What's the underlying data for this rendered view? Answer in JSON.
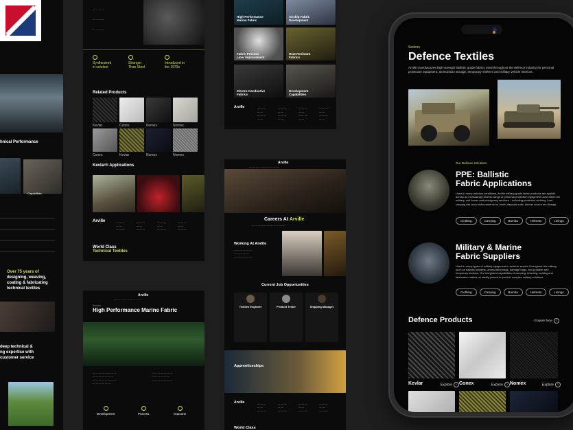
{
  "page1": {
    "hero_l1": "Synthesised",
    "hero_l1b": "in solution",
    "hero_l2": "Stronger",
    "hero_l2b": "Than Steel",
    "hero_l3": "Introduced in",
    "hero_l3b": "the 1970s",
    "related_title": "Related Products",
    "prod_row1": [
      "Kevlar",
      "Conex",
      "Nomex",
      "Nomex"
    ],
    "prod_row2": [
      "Conex",
      "Kevlar",
      "Nomex",
      "Nomex"
    ],
    "applications_title": "Kevlar® Applications",
    "brand": "Arville",
    "world_class_l1": "World Class",
    "world_class_l2": "Technical Textiles"
  },
  "page2": {
    "tile1": "High Performance",
    "tile1b": "Marine Fabric",
    "tile2": "Airship Fabric",
    "tile2b": "Development",
    "tile3": "Fabric Process",
    "tile3b": "Liner Improvement",
    "tile4": "Heat Resistant",
    "tile4b": "Fabrics",
    "tile5": "Electro-Conductive",
    "tile5b": "Fabrics",
    "tile6": "Development",
    "tile6b": "Capabilities",
    "brand": "Arville"
  },
  "page_left": {
    "perf": "hnical Performance",
    "capabilities": "Capabilities",
    "over": "Over 75 years of",
    "over2": "designing, weaving,",
    "over3": "coating & fabricating",
    "over4": "technical textiles",
    "deep1": "deep technical &",
    "deep2": "ng expertise with",
    "deep3": "customer service"
  },
  "page3": {
    "brand": "Arville",
    "breadcrumb": "Sectors",
    "title": "High Performance Marine Fabric",
    "step1": "Development",
    "step2": "Process",
    "step3": "Outcome"
  },
  "page4": {
    "brand": "Arville",
    "careers": "Careers At",
    "careers_brand": "Arville",
    "working": "Working At Arville",
    "jobs_title": "Current Job Opportunities",
    "job1": "Textiles Engineer",
    "job2": "Product Tester",
    "job3": "Shipping Manager",
    "apprenticeships": "Apprenticeships",
    "world_class": "World Class"
  },
  "phone": {
    "eyebrow": "Sectors",
    "title": "Defence Textiles",
    "intro": "Arville manufactures high-strength ballistic grade fabrics used throughout the defence industry for personal protection equipment, ammunition storage, temporary shelters and military vehicle interiors.",
    "solutions_label": "Our Defence Solutions",
    "ppe_l1": "PPE: Ballistic",
    "ppe_l2": "Fabric Applications",
    "ppe_text": "Used in many arduous conditions, Arville military grade fabric products are applied across an increasingly diverse range of personal protection equipment used within the military, civil forces and emergency services – including protective clothing, load carrying kits and reinforcements for bomb disposal suits, helmet covers and linings.",
    "ppe_pills": [
      "Clothing",
      "Carrying",
      "Bomba",
      "Helmets",
      "Linings"
    ],
    "mil_l1": "Military & Marine",
    "mil_l2": "Fabric Suppliers",
    "mil_text": "Used in many types of military equipment to achieve service throughout the military such as ballistic blankets, ammunition bags, damage bags, and portable and temporary shelters. Our integrated capabilities of weaving, finishing, coating and fabrication makes us ideally placed to provide complex military solutions.",
    "mil_pills": [
      "Clothing",
      "Carrying",
      "Bomba",
      "Helmets",
      "Linings"
    ],
    "products_title": "Defence Products",
    "enquire": "Enquire Now",
    "products": [
      "Kevlar",
      "Conex",
      "Nomex"
    ],
    "explore": "Explore"
  },
  "colors": {
    "accent": "#d7e04a",
    "logo_red": "#c8102e"
  }
}
